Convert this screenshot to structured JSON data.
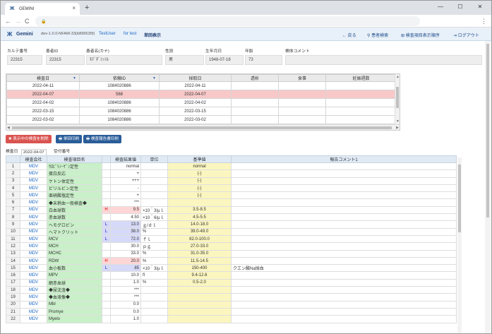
{
  "browser": {
    "tab_title": "GEMINI",
    "tab_icon": "Ж",
    "close_glyph": "×",
    "new_tab_glyph": "+",
    "back_glyph": "←",
    "forward_glyph": "→",
    "reload_glyph": "C",
    "lock_glyph": "🔒",
    "minimize_glyph": "—",
    "maximize_glyph": "☐",
    "window_close_glyph": "✕",
    "menu_glyph": "⋮"
  },
  "app": {
    "logo_glyph": "Ж",
    "logo_text": "Gemini",
    "version": "dev-1.0.0-NFAW-33(b896535f)",
    "user": "TestUser",
    "test": "for test",
    "mode": "単回表示",
    "nav": {
      "back": "戻る",
      "search": "患者検索",
      "order": "検査項目表示順序",
      "logout": "ログアウト"
    },
    "nav_icons": {
      "back": "←",
      "search": "⚲",
      "order": "⊞",
      "logout": "⇥"
    }
  },
  "patient": {
    "labels": {
      "karte": "カルテ番号",
      "patient_id": "患者ID",
      "kana": "患者名(カナ)",
      "sex": "性別",
      "birth": "生年月日",
      "age": "年齢",
      "specimen": "検体コメント"
    },
    "values": {
      "karte": "22315",
      "patient_id": "22315",
      "kana": "ﾓﾃﾞﾀﾞﾐｯﾐﾙ",
      "sex": "男",
      "birth": "1948-07-18",
      "age": "73",
      "specimen": ""
    }
  },
  "upper_table": {
    "headers": [
      "検査日",
      "依頼ID",
      "採取日",
      "透析",
      "食事",
      "妊娠週数"
    ],
    "dropdown_glyph": "▼",
    "rows": [
      {
        "date": "2022-04-11",
        "id": "1084020886",
        "collect": "2022-04-11",
        "dialysis": "",
        "meal": "",
        "preg": "",
        "selected": false
      },
      {
        "date": "2022-04-07",
        "id": "568",
        "collect": "2022-04-07",
        "dialysis": "",
        "meal": "",
        "preg": "",
        "selected": true
      },
      {
        "date": "2022-04-02",
        "id": "1084020886",
        "collect": "2022-04-02",
        "dialysis": "",
        "meal": "",
        "preg": "",
        "selected": false
      },
      {
        "date": "2022-03-15",
        "id": "1084020886",
        "collect": "2022-03-15",
        "dialysis": "",
        "meal": "",
        "preg": "",
        "selected": false
      },
      {
        "date": "2022-03-02",
        "id": "1084020886",
        "collect": "2022-03-02",
        "dialysis": "",
        "meal": "",
        "preg": "",
        "selected": false
      }
    ]
  },
  "buttons": {
    "delete": "✖ 表示中の検査を削除",
    "print": "🖶 単回印刷",
    "report": "🖶 検査報告書印刷"
  },
  "sub_tabs": {
    "label": "検査日",
    "date": "2022-04-07",
    "receipt": "受付番号"
  },
  "results": {
    "headers": [
      "",
      "検査会社",
      "検査項目名",
      "",
      "検査結果値",
      "単位",
      "基準値",
      "報告コメント1"
    ],
    "rows": [
      {
        "no": "1",
        "co": "MDV",
        "name": "ｳﾛﾋﾞﾘﾉｰｹﾞﾝ定性",
        "flag": "",
        "value": "normal",
        "unit": "",
        "ref": "normal",
        "comment": ""
      },
      {
        "no": "2",
        "co": "MDV",
        "name": "蛋白反応",
        "flag": "",
        "value": "+",
        "unit": "",
        "ref": "(-)",
        "comment": ""
      },
      {
        "no": "3",
        "co": "MDV",
        "name": "ケトン体定性",
        "flag": "",
        "value": "+++",
        "unit": "",
        "ref": "(-)",
        "comment": ""
      },
      {
        "no": "4",
        "co": "MDV",
        "name": "ビリルビン定性",
        "flag": "",
        "value": "-",
        "unit": "",
        "ref": "(-)",
        "comment": ""
      },
      {
        "no": "5",
        "co": "MDV",
        "name": "亜硝酸塩定性",
        "flag": "",
        "value": "+",
        "unit": "",
        "ref": "(-)",
        "comment": ""
      },
      {
        "no": "6",
        "co": "MDV",
        "name": "◆末梢血一般検査◆",
        "flag": "",
        "value": "***",
        "unit": "",
        "ref": "",
        "comment": ""
      },
      {
        "no": "7",
        "co": "MDV",
        "name": "白血球数",
        "flag": "H",
        "value": "9.5",
        "unit": "×10＾3/μｌ",
        "ref": "3.5-8.5",
        "comment": ""
      },
      {
        "no": "8",
        "co": "MDV",
        "name": "赤血球数",
        "flag": "",
        "value": "4.50",
        "unit": "×10＾6/μｌ",
        "ref": "4.5-5.5",
        "comment": ""
      },
      {
        "no": "9",
        "co": "MDV",
        "name": "ヘモグロビン",
        "flag": "L",
        "value": "13.0",
        "unit": "ｇ/ｄｌ",
        "ref": "14.0-18.0",
        "comment": ""
      },
      {
        "no": "10",
        "co": "MDV",
        "name": "ヘマトクリット",
        "flag": "L",
        "value": "38.0",
        "unit": "%",
        "ref": "39.0-49.0",
        "comment": ""
      },
      {
        "no": "11",
        "co": "MDV",
        "name": "MCV",
        "flag": "L",
        "value": "72.0",
        "unit": "ｆｌ",
        "ref": "82.0-100.0",
        "comment": ""
      },
      {
        "no": "12",
        "co": "MDV",
        "name": "MCH",
        "flag": "",
        "value": "30.0",
        "unit": "ｐｇ",
        "ref": "27.0-33.0",
        "comment": ""
      },
      {
        "no": "13",
        "co": "MDV",
        "name": "MCHC",
        "flag": "",
        "value": "33.0",
        "unit": "%",
        "ref": "31.0-35.0",
        "comment": ""
      },
      {
        "no": "14",
        "co": "MDV",
        "name": "RDW",
        "flag": "H",
        "value": "20.0",
        "unit": "%",
        "ref": "11.5-14.5",
        "comment": ""
      },
      {
        "no": "15",
        "co": "MDV",
        "name": "血小板数",
        "flag": "L",
        "value": "85",
        "unit": "×10＾3/μｌ",
        "ref": "150-400",
        "comment": "クエン酸Na採血"
      },
      {
        "no": "16",
        "co": "MDV",
        "name": "MPV",
        "flag": "",
        "value": "10.0",
        "unit": "fl",
        "ref": "9.4-12.6",
        "comment": ""
      },
      {
        "no": "17",
        "co": "MDV",
        "name": "網赤血球",
        "flag": "",
        "value": "1.0",
        "unit": "%",
        "ref": "0.5-2.0",
        "comment": ""
      },
      {
        "no": "18",
        "co": "MDV",
        "name": "◆尿沈渣◆",
        "flag": "",
        "value": "***",
        "unit": "",
        "ref": "",
        "comment": ""
      },
      {
        "no": "19",
        "co": "MDV",
        "name": "◆血液像◆",
        "flag": "",
        "value": "***",
        "unit": "",
        "ref": "",
        "comment": ""
      },
      {
        "no": "20",
        "co": "MDV",
        "name": "Mbl",
        "flag": "",
        "value": "0.0",
        "unit": "",
        "ref": "",
        "comment": ""
      },
      {
        "no": "21",
        "co": "MDV",
        "name": "Promye",
        "flag": "",
        "value": "0.0",
        "unit": "",
        "ref": "",
        "comment": ""
      },
      {
        "no": "22",
        "co": "MDV",
        "name": "Myelo",
        "flag": "",
        "value": "1.0",
        "unit": "",
        "ref": "",
        "comment": ""
      }
    ]
  }
}
